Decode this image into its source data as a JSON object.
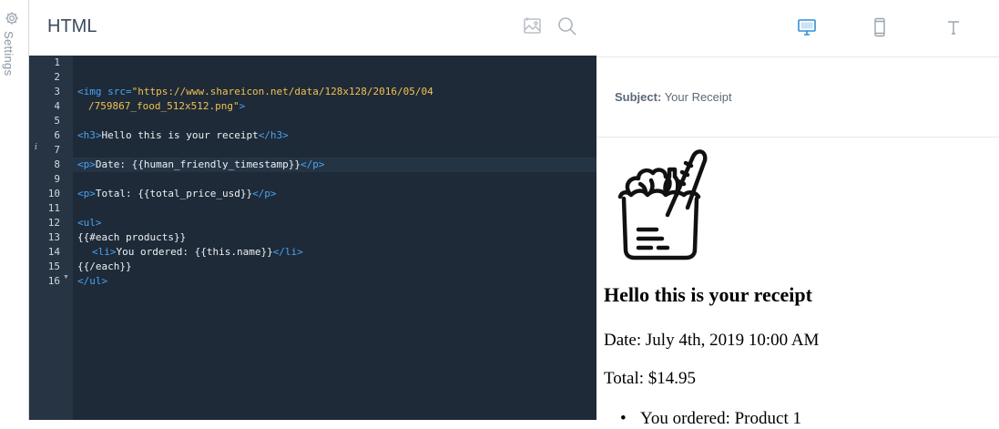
{
  "settings": {
    "label": "Settings"
  },
  "editor": {
    "title": "HTML",
    "line_numbers": [
      "1",
      "2",
      "3",
      "4",
      "5",
      "6",
      "7",
      "8",
      "9",
      "10",
      "11",
      "12",
      "13",
      "14",
      "15",
      "16"
    ],
    "code": {
      "line3a": {
        "open": "<img src=",
        "str": "\"https://www.shareicon.net/data/128x128/2016/05/04"
      },
      "line3b": {
        "str": "/759867_food_512x512.png\"",
        "close": ">"
      },
      "line5": {
        "open": "<h3>",
        "text": "Hello this is your receipt",
        "close": "</h3>"
      },
      "line7": {
        "open": "<p>",
        "text": "Date: {{human_friendly_timestamp}}",
        "close": "</p>"
      },
      "line9": {
        "open": "<p>",
        "text": "Total: {{total_price_usd}}",
        "close": "</p>"
      },
      "line11": {
        "open": "<ul>"
      },
      "line12": {
        "text": "{{#each products}}"
      },
      "line13": {
        "open": "<li>",
        "text": "You ordered: {{this.name}}",
        "close": "</li>"
      },
      "line14": {
        "text": "{{/each}}"
      },
      "line15": {
        "close": "</ul>"
      }
    }
  },
  "preview": {
    "subject_label": "Subject:",
    "subject_value": "Your Receipt",
    "heading": "Hello this is your receipt",
    "date": "Date: July 4th, 2019 10:00 AM",
    "total": "Total: $14.95",
    "items": [
      "You ordered: Product 1"
    ]
  },
  "colors": {
    "accent": "#2f8fd8",
    "editor_bg": "#1e2a38",
    "gutter_bg": "#263444",
    "tag": "#4aa3f2",
    "string": "#f2c14e"
  },
  "icons": [
    "gear-icon",
    "image-icon",
    "search-icon",
    "desktop-icon",
    "mobile-icon",
    "text-icon",
    "grocery-bag-icon"
  ]
}
